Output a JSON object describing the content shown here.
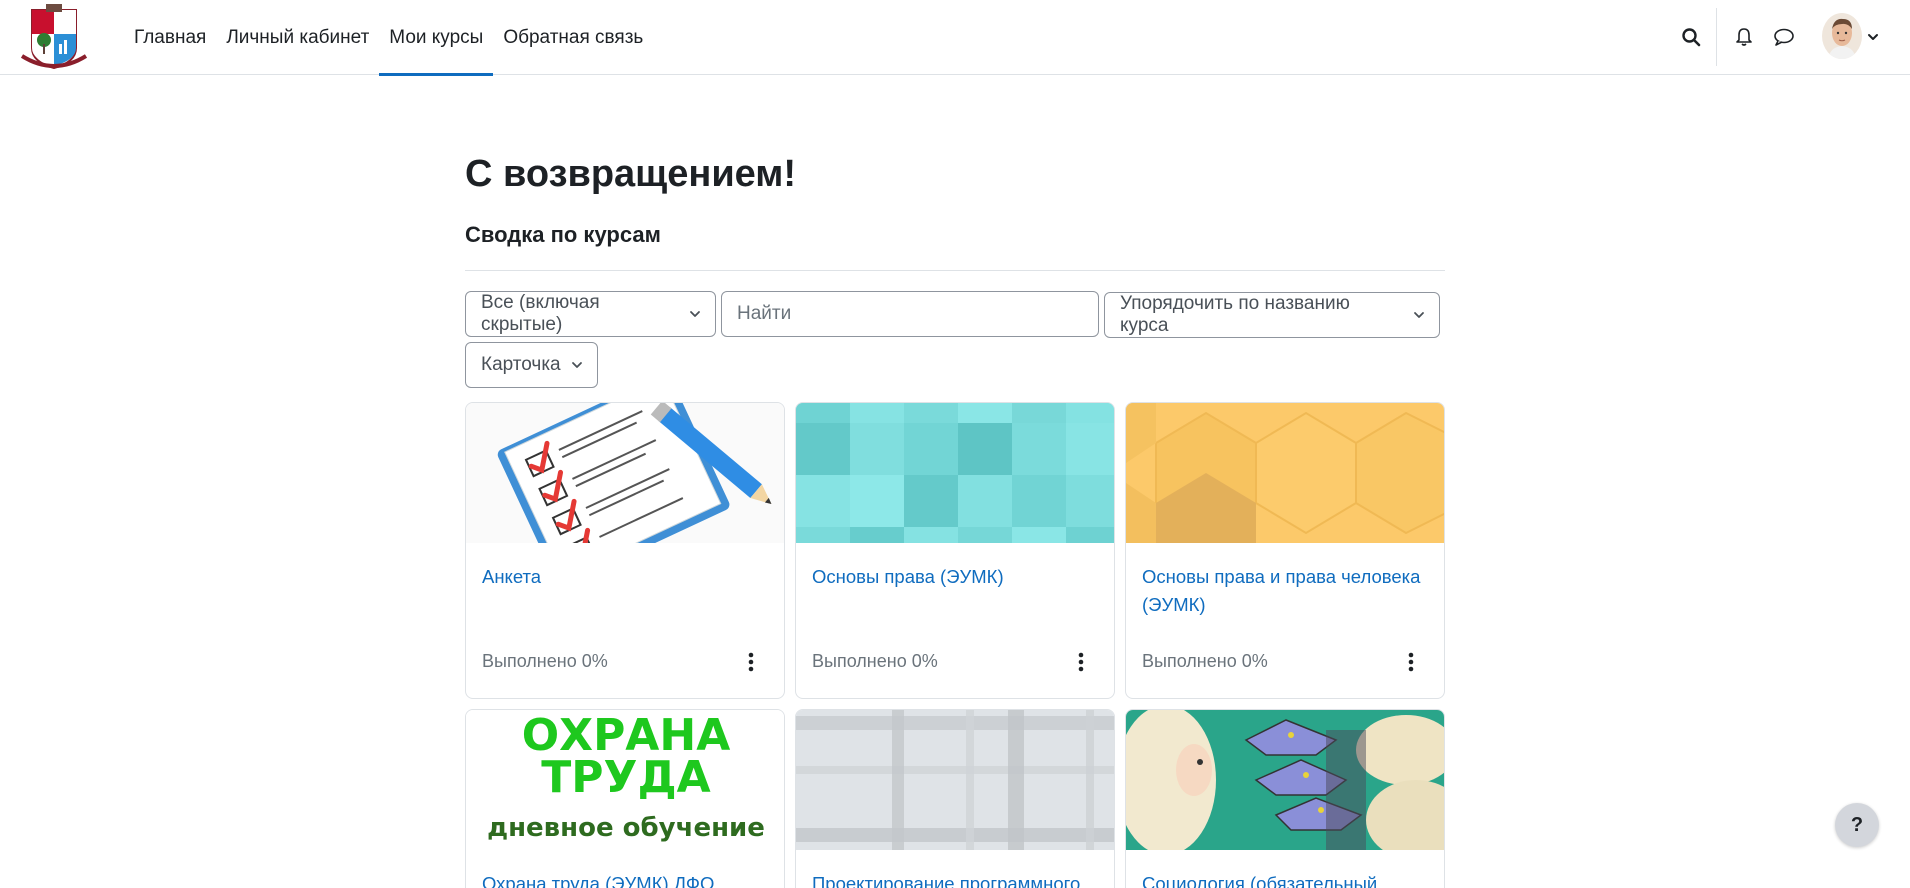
{
  "nav": {
    "links": [
      {
        "label": "Главная"
      },
      {
        "label": "Личный кабинет"
      },
      {
        "label": "Мои курсы",
        "active": true
      },
      {
        "label": "Обратная связь"
      }
    ],
    "icons": [
      "search-icon",
      "bell-icon",
      "chat-icon",
      "chevron-down-icon"
    ]
  },
  "main": {
    "title": "С возвращением!",
    "section_title": "Сводка по курсам",
    "filter_label": "Все (включая скрытые)",
    "search_placeholder": "Найти",
    "sort_label": "Упорядочить по названию курса",
    "view_label": "Карточка"
  },
  "courses": [
    {
      "title": "Анкета",
      "progress": "Выполнено 0%"
    },
    {
      "title": "Основы права (ЭУМК)",
      "progress": "Выполнено 0%"
    },
    {
      "title": "Основы права и права человека (ЭУМК)",
      "progress": "Выполнено 0%"
    },
    {
      "title": "Охрана труда (ЭУМК) ДФО",
      "progress": "",
      "image_text_1": "ОХРАНА",
      "image_text_2": "ТРУДА",
      "image_text_3": "дневное обучение"
    },
    {
      "title": "Проектирование программного",
      "progress": ""
    },
    {
      "title": "Социология (обязательный",
      "progress": ""
    }
  ],
  "help": {
    "label": "?"
  },
  "colors": {
    "accent": "#0f6cbf",
    "border": "#dee2e6",
    "text": "#1d2125"
  }
}
